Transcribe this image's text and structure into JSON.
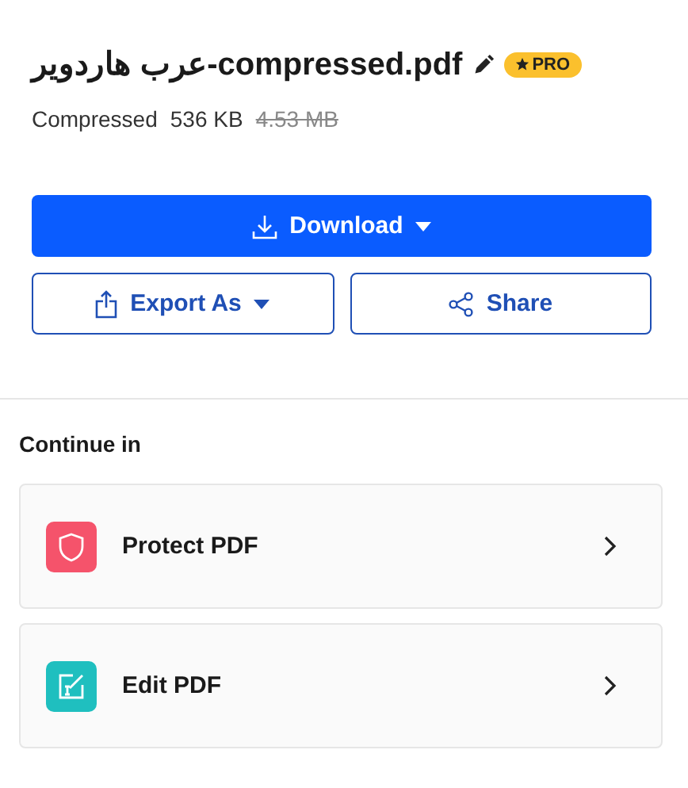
{
  "file": {
    "name": "عرب هاردویر-compressed.pdf",
    "badge": "PRO",
    "status": "Compressed",
    "new_size": "536 KB",
    "original_size": "4.53 MB"
  },
  "actions": {
    "download": "Download",
    "export": "Export As",
    "share": "Share"
  },
  "continue_in": {
    "heading": "Continue in",
    "tools": [
      {
        "label": "Protect PDF",
        "kind": "shield",
        "color": "#f5536b"
      },
      {
        "label": "Edit PDF",
        "kind": "edit",
        "color": "#1fbfbf"
      }
    ]
  }
}
